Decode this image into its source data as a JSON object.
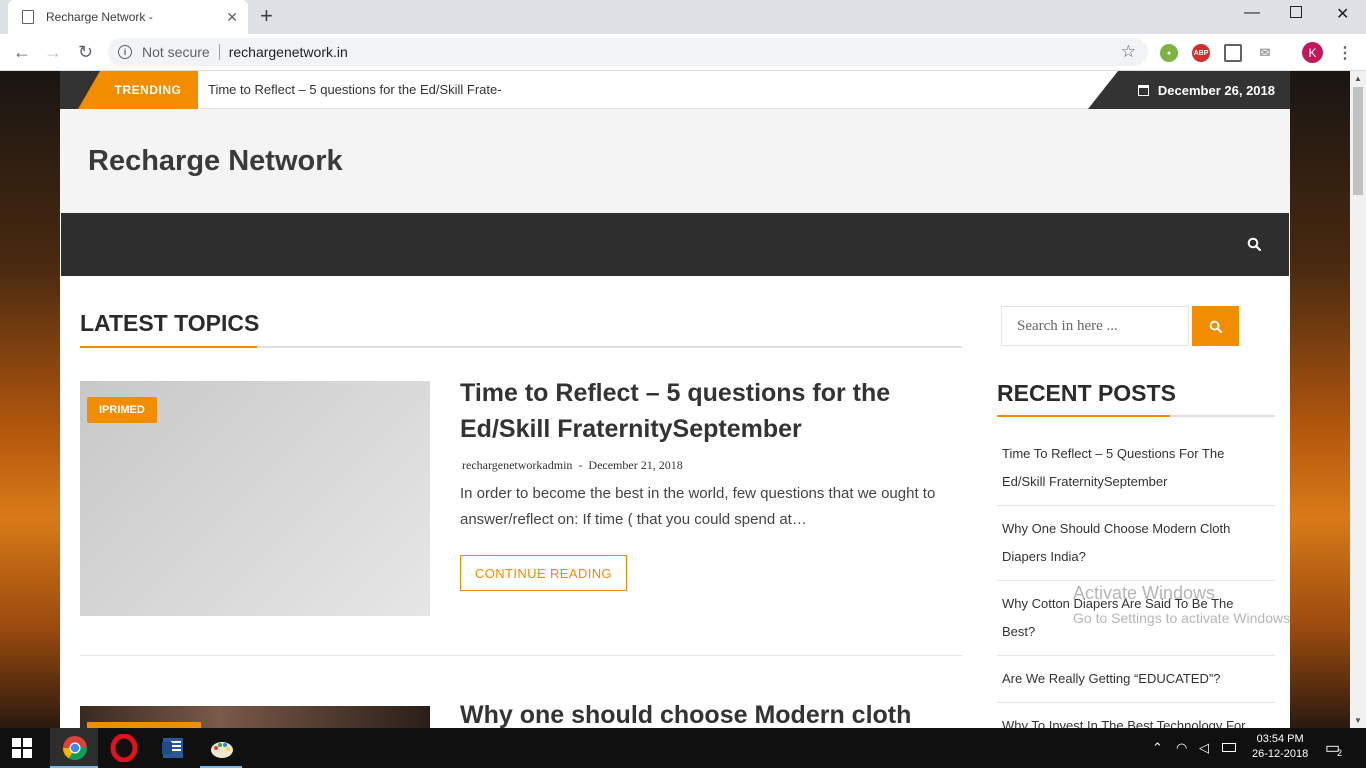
{
  "browser": {
    "tab_title": "Recharge Network -",
    "new_tab": "+",
    "not_secure": "Not secure",
    "url": "rechargenetwork.in",
    "avatar_initial": "K",
    "ext_abp": "ABP"
  },
  "site": {
    "trending_label": "TRENDING",
    "trending_text": "Time to Reflect – 5 questions for the Ed/Skill Frate-",
    "date": "December 26, 2018",
    "title": "Recharge Network",
    "section_title": "LATEST TOPICS",
    "posts": [
      {
        "badge": "IPRIMED",
        "title": "Time to Reflect – 5 questions for the Ed/Skill FraternitySeptember",
        "author": "rechargenetworkadmin",
        "date": "December 21, 2018",
        "excerpt": "In order to become the best in the world, few questions that we ought to answer/reflect on: If time ( that you could spend at…",
        "button": "CONTINUE READING"
      },
      {
        "title": "Why one should choose Modern cloth"
      }
    ],
    "sidebar": {
      "search_placeholder": "Search in here ...",
      "recent_title": "RECENT POSTS",
      "recent_posts": [
        "Time To Reflect – 5 Questions For The Ed/Skill FraternitySeptember",
        "Why One Should Choose Modern Cloth Diapers India?",
        "Why Cotton Diapers Are Said To Be The Best?",
        "Are We Really Getting “EDUCATED”?",
        "Why To Invest In The Best Technology For"
      ]
    }
  },
  "watermark": {
    "line1": "Activate Windows",
    "line2": "Go to Settings to activate Windows."
  },
  "taskbar": {
    "time": "03:54 PM",
    "date": "26-12-2018",
    "notifications": "2"
  },
  "colors": {
    "accent": "#f28c00",
    "dark": "#2e2e2e"
  }
}
